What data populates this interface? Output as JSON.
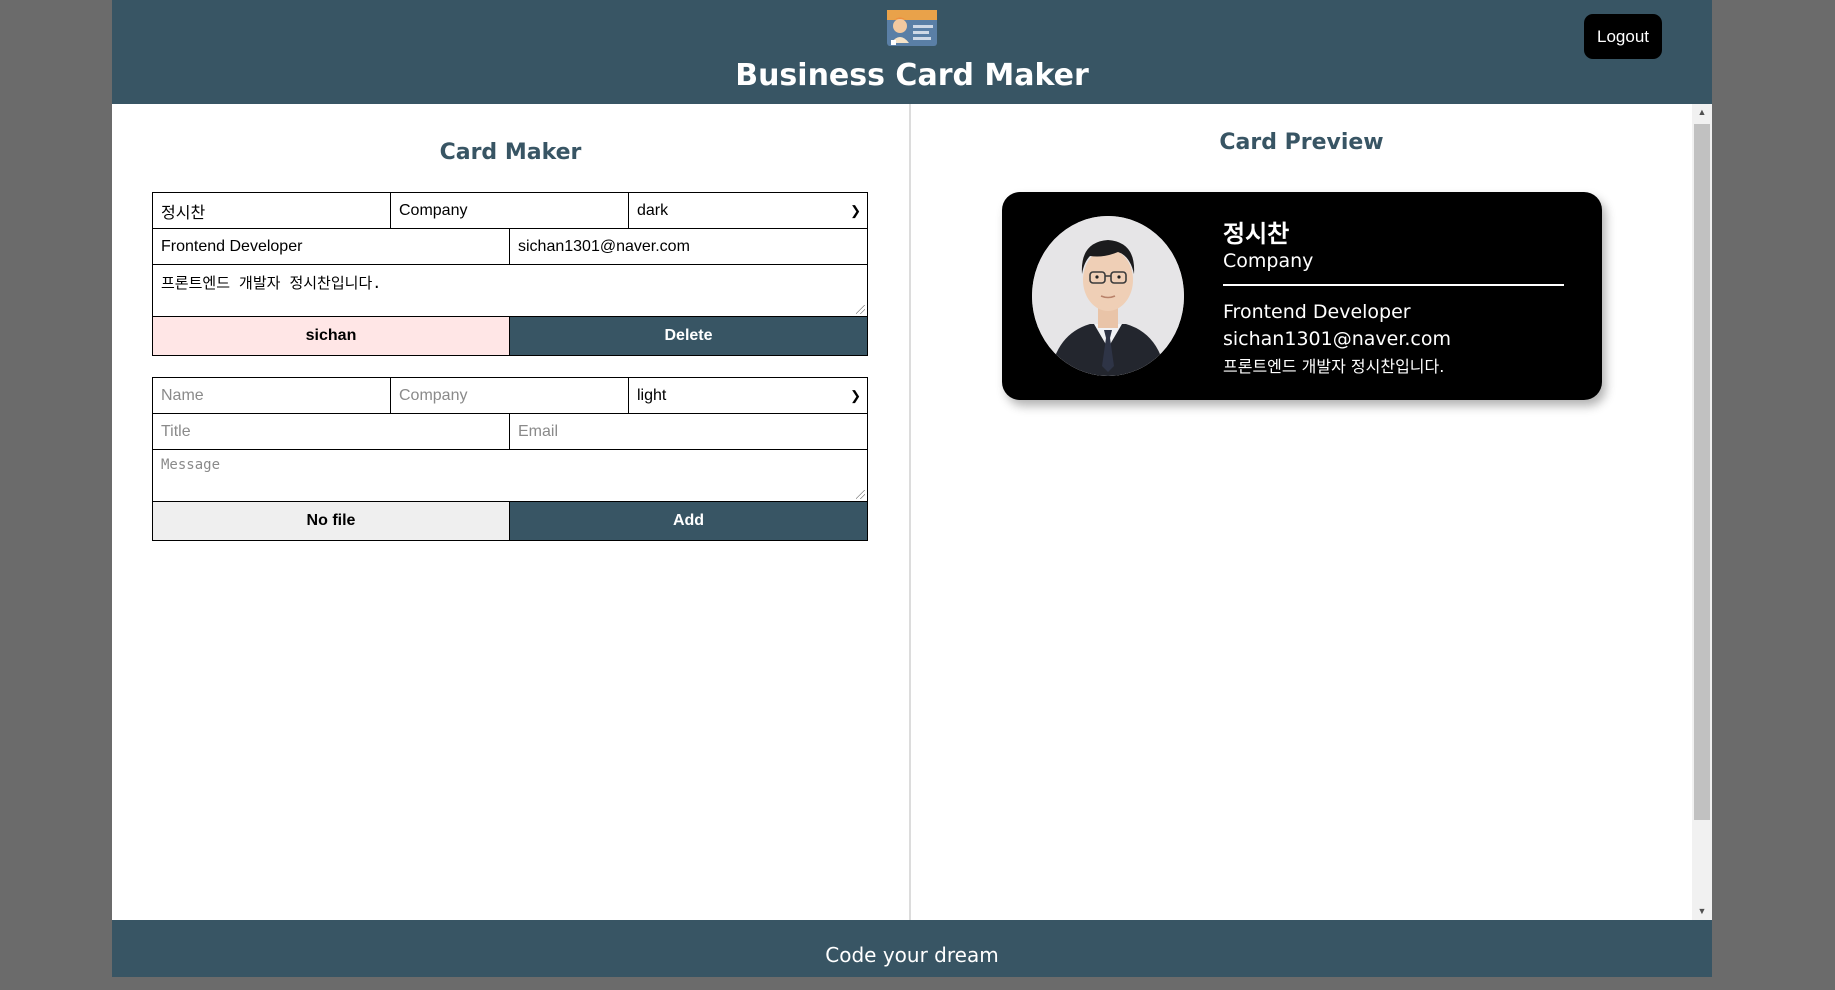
{
  "header": {
    "title": "Business Card Maker",
    "logout_label": "Logout",
    "logo_icon": "business-card-logo-icon"
  },
  "maker": {
    "title": "Card Maker",
    "existing_card": {
      "name": "정시찬",
      "company": "Company",
      "theme": "dark",
      "title": "Frontend Developer",
      "email": "sichan1301@naver.com",
      "message": "프론트엔드 개발자 정시찬입니다.",
      "file_label": "sichan",
      "delete_label": "Delete"
    },
    "new_card": {
      "name_placeholder": "Name",
      "company_placeholder": "Company",
      "theme": "light",
      "title_placeholder": "Title",
      "email_placeholder": "Email",
      "message_placeholder": "Message",
      "file_label": "No file",
      "add_label": "Add"
    }
  },
  "preview": {
    "title": "Card Preview",
    "card": {
      "name": "정시찬",
      "company": "Company",
      "title": "Frontend Developer",
      "email": "sichan1301@naver.com",
      "message": "프론트엔드 개발자 정시찬입니다.",
      "theme": "dark"
    }
  },
  "footer": {
    "text": "Code your dream"
  },
  "colors": {
    "brand": "#385564",
    "file_uploaded_bg": "#ffe6e6",
    "card_dark_bg": "#000000"
  }
}
